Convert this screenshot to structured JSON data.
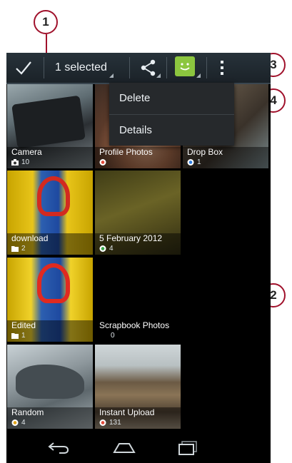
{
  "action_bar": {
    "selected_label": "1 selected"
  },
  "menu": {
    "items": [
      {
        "label": "Delete"
      },
      {
        "label": "Details"
      }
    ]
  },
  "albums": [
    {
      "name": "Camera",
      "count": "10",
      "icon": "camera-icon"
    },
    {
      "name": "Profile Photos",
      "count": "",
      "icon": "picasa-icon"
    },
    {
      "name": "Drop Box",
      "count": "1",
      "icon": "picasa-icon"
    },
    {
      "name": "download",
      "count": "2",
      "icon": "folder-icon"
    },
    {
      "name": "5 February 2012",
      "count": "4",
      "icon": "picasa-icon"
    },
    {
      "name": "Edited",
      "count": "1",
      "icon": "folder-icon"
    },
    {
      "name": "Scrapbook Photos",
      "count": "0",
      "icon": ""
    },
    {
      "name": "Random",
      "count": "4",
      "icon": "picasa-icon"
    },
    {
      "name": "Instant Upload",
      "count": "131",
      "icon": "picasa-icon"
    }
  ],
  "callouts": [
    {
      "number": "1"
    },
    {
      "number": "2"
    },
    {
      "number": "3"
    },
    {
      "number": "4"
    }
  ],
  "colors": {
    "accent_select": "#4fb6e6",
    "callout": "#a0112b",
    "messaging_green": "#8cc63f"
  }
}
